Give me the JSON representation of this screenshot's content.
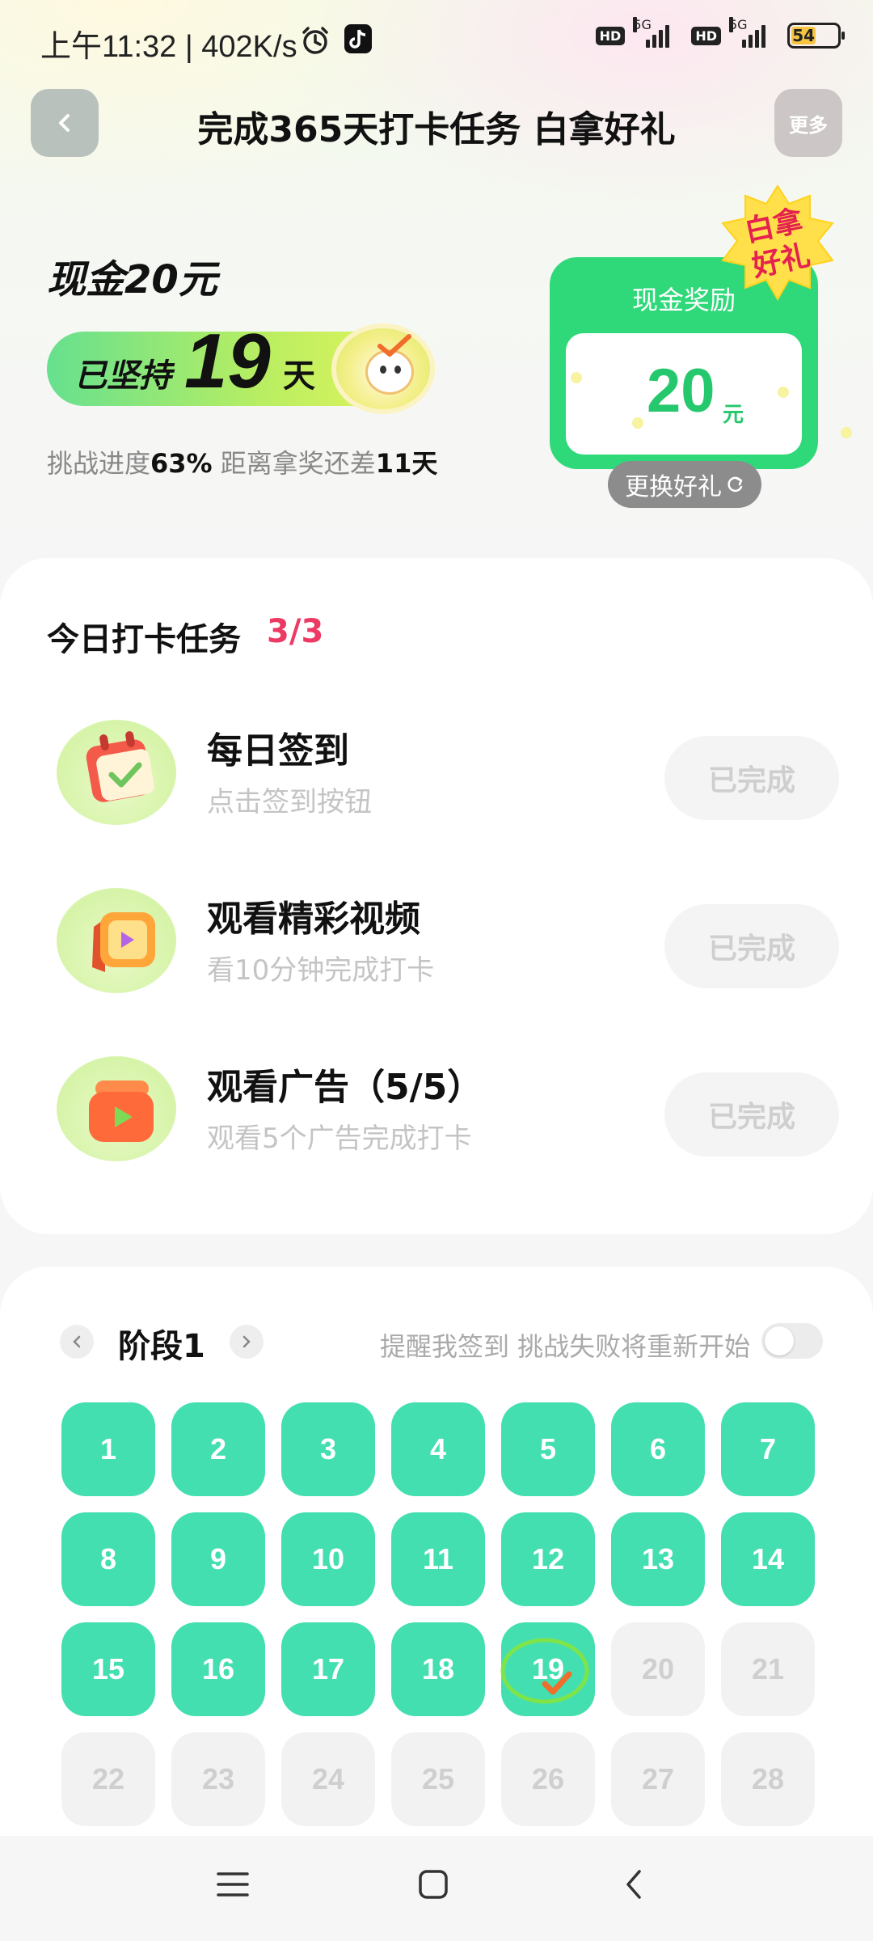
{
  "status_bar": {
    "time": "上午11:32 | 402K/s",
    "alarm_icon": "alarm-icon",
    "tiktok_icon": "tiktok-icon",
    "hd1": "HD",
    "net1": "5G",
    "hd2": "HD",
    "net2": "5G",
    "battery": "54"
  },
  "header": {
    "back_icon": "chevron-left-icon",
    "title": "完成365天打卡任务 白拿好礼",
    "more_label": "更多"
  },
  "hero": {
    "cash_title": "现金20元",
    "streak_prefix": "已坚持",
    "streak_days": "19",
    "streak_suffix": "天",
    "progress_prefix": "挑战进度",
    "progress_value": "63%",
    "progress_mid": " 距离拿奖还差",
    "remaining_days": "11天",
    "progress_fraction": 0.63
  },
  "reward": {
    "label": "现金奖励",
    "amount": "20",
    "unit": "元",
    "badge_line1": "白拿",
    "badge_line2": "好礼",
    "swap_label": "更换好礼",
    "swap_icon": "refresh-icon"
  },
  "tasks": {
    "heading": "今日打卡任务",
    "count": "3/3",
    "items": [
      {
        "title": "每日签到",
        "subtitle": "点击签到按钮",
        "button": "已完成",
        "icon": "calendar-check-icon"
      },
      {
        "title": "观看精彩视频",
        "subtitle": "看10分钟完成打卡",
        "button": "已完成",
        "icon": "video-play-icon"
      },
      {
        "title": "观看广告（5/5）",
        "subtitle": "观看5个广告完成打卡",
        "button": "已完成",
        "icon": "ad-play-icon"
      }
    ]
  },
  "calendar": {
    "stage_label": "阶段1",
    "prev_icon": "chevron-left-icon",
    "next_icon": "chevron-right-icon",
    "remind_text": "提醒我签到 挑战失败将重新开始",
    "remind_enabled": false,
    "today": 19,
    "days": [
      "1",
      "2",
      "3",
      "4",
      "5",
      "6",
      "7",
      "8",
      "9",
      "10",
      "11",
      "12",
      "13",
      "14",
      "15",
      "16",
      "17",
      "18",
      "19",
      "20",
      "21",
      "22",
      "23",
      "24",
      "25",
      "26",
      "27",
      "28"
    ],
    "completed_through": 19
  },
  "nav": {
    "menu_icon": "menu-icon",
    "home_icon": "home-square-icon",
    "back_icon": "back-triangle-icon"
  },
  "colors": {
    "accent_green": "#2fd97a",
    "day_done": "#44dfb0",
    "count_red": "#ec3a64"
  }
}
